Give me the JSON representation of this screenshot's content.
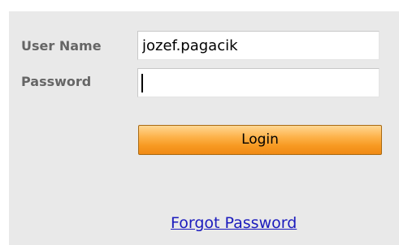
{
  "login_form": {
    "username_label": "User Name",
    "username_value": "jozef.pagacik",
    "password_label": "Password",
    "password_value": "",
    "login_button_label": "Login",
    "forgot_password_link": "Forgot Password"
  },
  "colors": {
    "panel_background": "#e9e9e9",
    "label_text": "#666666",
    "button_orange": "#f79a22",
    "link_blue": "#1b1bbd"
  }
}
